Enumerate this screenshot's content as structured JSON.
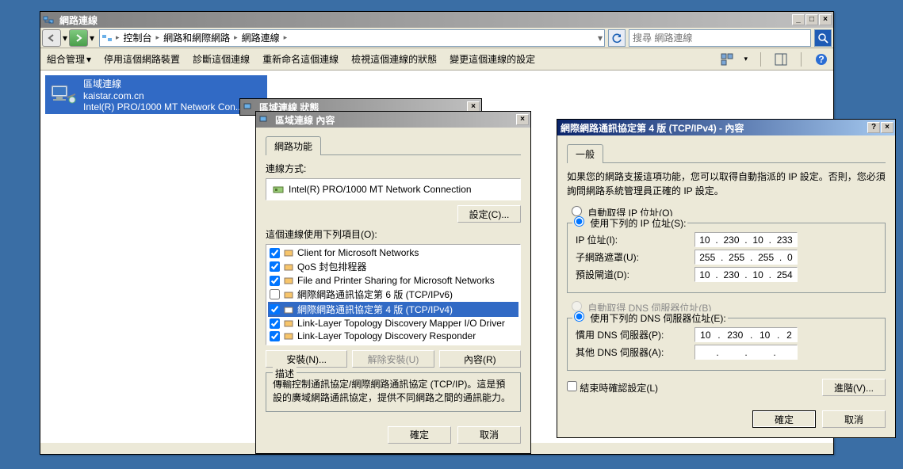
{
  "explorer": {
    "title": "網路連線",
    "nav": {
      "breadcrumbs": [
        "控制台",
        "網路和網際網路",
        "網路連線"
      ],
      "search_placeholder": "搜尋 網路連線"
    },
    "toolbar": {
      "org": "組合管理",
      "disable": "停用這個網路裝置",
      "diagnose": "診斷這個連線",
      "rename": "重新命名這個連線",
      "status": "檢視這個連線的狀態",
      "change": "變更這個連線的設定"
    },
    "connection": {
      "name": "區域連線",
      "domain": "kaistar.com.cn",
      "adapter": "Intel(R) PRO/1000 MT Network Con..."
    }
  },
  "dlg_status": {
    "title": "區域連線 狀態"
  },
  "dlg_props": {
    "title": "區域連線 內容",
    "tab_label": "網路功能",
    "connect_using": "連線方式:",
    "adapter": "Intel(R) PRO/1000 MT Network Connection",
    "configure_btn": "設定(C)...",
    "items_label": "這個連線使用下列項目(O):",
    "items": [
      {
        "checked": true,
        "label": "Client for Microsoft Networks"
      },
      {
        "checked": true,
        "label": "QoS 封包排程器"
      },
      {
        "checked": true,
        "label": "File and Printer Sharing for Microsoft Networks"
      },
      {
        "checked": false,
        "label": "網際網路通訊協定第 6 版 (TCP/IPv6)"
      },
      {
        "checked": true,
        "label": "網際網路通訊協定第 4 版 (TCP/IPv4)",
        "selected": true
      },
      {
        "checked": true,
        "label": "Link-Layer Topology Discovery Mapper I/O Driver"
      },
      {
        "checked": true,
        "label": "Link-Layer Topology Discovery Responder"
      }
    ],
    "install_btn": "安裝(N)...",
    "uninstall_btn": "解除安裝(U)",
    "properties_btn": "內容(R)",
    "desc_title": "描述",
    "desc_text": "傳輸控制通訊協定/網際網路通訊協定 (TCP/IP)。這是預設的廣域網路通訊協定，提供不同網路之間的通訊能力。",
    "ok": "確定",
    "cancel": "取消"
  },
  "dlg_ipv4": {
    "title": "網際網路通訊協定第 4 版 (TCP/IPv4) - 內容",
    "tab_label": "一般",
    "intro": "如果您的網路支援這項功能，您可以取得自動指派的 IP 設定。否則，您必須詢問網路系統管理員正確的 IP 設定。",
    "auto_ip": "自動取得 IP 位址(O)",
    "manual_ip": "使用下列的 IP 位址(S):",
    "fields": {
      "ip_label": "IP 位址(I):",
      "ip": [
        "10",
        "230",
        "10",
        "233"
      ],
      "mask_label": "子網路遮罩(U):",
      "mask": [
        "255",
        "255",
        "255",
        "0"
      ],
      "gw_label": "預設閘道(D):",
      "gw": [
        "10",
        "230",
        "10",
        "254"
      ]
    },
    "auto_dns": "自動取得 DNS 伺服器位址(B)",
    "manual_dns": "使用下列的 DNS 伺服器位址(E):",
    "dns": {
      "pref_label": "慣用 DNS 伺服器(P):",
      "pref": [
        "10",
        "230",
        "10",
        "2"
      ],
      "alt_label": "其他 DNS 伺服器(A):",
      "alt": [
        "",
        "",
        "",
        ""
      ]
    },
    "validate": "結束時確認設定(L)",
    "advanced": "進階(V)...",
    "ok": "確定",
    "cancel": "取消"
  }
}
